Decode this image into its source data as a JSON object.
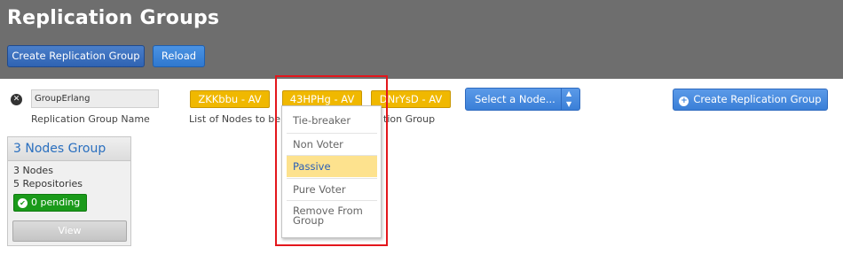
{
  "header": {
    "title": "Replication Groups",
    "create_button": "Create Replication Group",
    "reload_button": "Reload"
  },
  "form": {
    "group_name_value": "GroupErlang",
    "group_name_caption": "Replication Group Name",
    "nodes_caption": "List of Nodes to be",
    "nodes_caption_tail": "tion Group",
    "selected_nodes": [
      "ZKKbbu - AV",
      "43HPHg - AV",
      "DNrYsD - AV"
    ],
    "select_node_label": "Select a Node...",
    "create_button": "Create Replication Group"
  },
  "dropdown": {
    "items": [
      "Tie-breaker",
      "Non Voter",
      "Passive",
      "Pure Voter",
      "Remove From Group"
    ],
    "active": "Passive"
  },
  "group_card": {
    "title": "3 Nodes Group",
    "nodes": "3 Nodes",
    "repositories": "5 Repositories",
    "pending": "0 pending",
    "view_button": "View"
  },
  "colors": {
    "header_bg": "#6e6e6e",
    "node_pill": "#f0b800",
    "pending_badge": "#1a9a1a",
    "highlight_border": "#e3161c",
    "active_item_bg": "#fde28e"
  },
  "icons": {
    "clear": "close-circle-icon",
    "create": "plus-circle-icon",
    "pending": "check-circle-icon",
    "select_arrows": "updown-arrows-icon"
  }
}
